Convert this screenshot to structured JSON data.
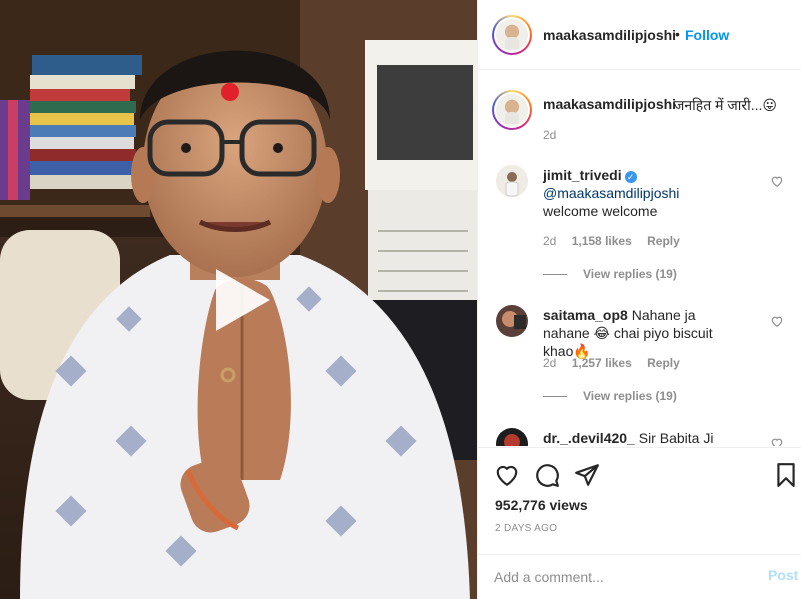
{
  "header": {
    "username": "maakasamdilipjoshi",
    "separator": "•",
    "follow_label": "Follow",
    "more_icon": "more-horizontal-icon"
  },
  "caption": {
    "username": "maakasamdilipjoshi",
    "text": "जनहित में जारी...😛",
    "time": "2d"
  },
  "comments": [
    {
      "username": "jimit_trivedi",
      "verified": true,
      "mention": "@maakasamdilipjoshi",
      "text": " welcome welcome",
      "time": "2d",
      "likes": "1,158 likes",
      "reply_label": "Reply",
      "view_replies": "View replies (19)"
    },
    {
      "username": "saitama_op8",
      "verified": false,
      "text": " Nahane ja nahane 😂 chai piyo biscuit khao🔥",
      "time": "2d",
      "likes": "1,257 likes",
      "reply_label": "Reply",
      "view_replies": "View replies (19)"
    },
    {
      "username": "dr._.devil420_",
      "verified": false,
      "text": " Sir Babita Ji kaisi"
    }
  ],
  "actions": {
    "like_icon": "heart-icon",
    "comment_icon": "comment-icon",
    "share_icon": "share-icon",
    "save_icon": "bookmark-icon",
    "views": "952,776 views",
    "posted": "2 DAYS AGO"
  },
  "add_comment": {
    "placeholder": "Add a comment...",
    "post_label": "Post"
  },
  "colors": {
    "accent": "#0095f6",
    "muted": "#8e8e8e",
    "text": "#262626",
    "border": "#efefef",
    "post_disabled": "#b2dffc"
  }
}
